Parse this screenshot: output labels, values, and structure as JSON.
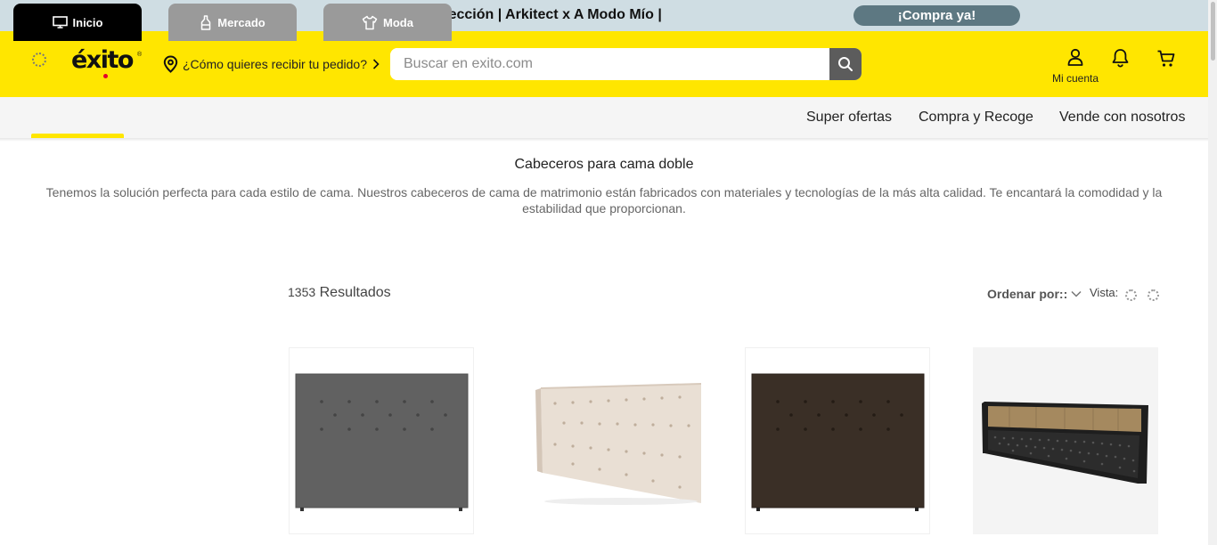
{
  "promo": {
    "text": "Nueva colección | Arkitect x A Modo Mío |",
    "button": "¡Compra ya!"
  },
  "header": {
    "logo": "éxito",
    "logo_mark": "®",
    "location_prompt": "¿Cómo quieres recibir tu pedido?",
    "search_placeholder": "Buscar en exito.com",
    "account_label": "Mi cuenta",
    "icons": [
      "spinner-icon",
      "location-pin-icon",
      "chevron-right-icon",
      "search-icon",
      "user-icon",
      "bell-icon",
      "cart-icon"
    ]
  },
  "nav": {
    "tabs": [
      {
        "label": "Inicio",
        "icon": "monitor-icon",
        "active": true
      },
      {
        "label": "Mercado",
        "icon": "bottle-icon",
        "active": false
      },
      {
        "label": "Moda",
        "icon": "shirt-icon",
        "active": false
      }
    ],
    "links": [
      "Super ofertas",
      "Compra y Recoge",
      "Vende con nosotros"
    ]
  },
  "category": {
    "title": "Cabeceros para cama doble",
    "description": "Tenemos la solución perfecta para cada estilo de cama. Nuestros cabeceros de cama de matrimonio están fabricados con materiales y tecnologías de la más alta calidad. Te encantará la comodidad y la estabilidad que proporcionan."
  },
  "results": {
    "count": "1353",
    "label": "Resultados",
    "sort_label": "Ordenar por::",
    "view_label": "Vista:"
  },
  "products": [
    {
      "image": "gray-tufted-headboard",
      "color": "#5f5f5f"
    },
    {
      "image": "beige-tufted-headboard",
      "color": "#e8ddd2"
    },
    {
      "image": "brown-tufted-headboard",
      "color": "#3a2f26"
    },
    {
      "image": "wood-metal-headboard",
      "color": "#a08868"
    }
  ],
  "colors": {
    "brand_yellow": "#ffe600",
    "promo_bg": "#cfdde3",
    "promo_button": "#5d7882",
    "tab_active": "#000000",
    "tab_inactive": "#9a9a9a"
  }
}
